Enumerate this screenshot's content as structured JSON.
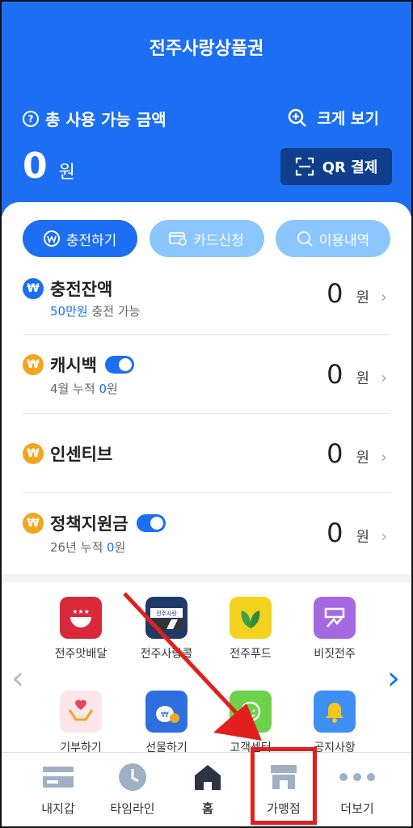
{
  "header": {
    "app_title": "전주사랑상품권",
    "total_label": "총 사용 가능 금액",
    "zoom_label": "크게 보기",
    "total_amount": "0",
    "total_unit": "원",
    "qr_label": "QR 결제",
    "bg_color": "#1c6ef2"
  },
  "actions": [
    {
      "label": "충전하기",
      "icon": "won-icon"
    },
    {
      "label": "카드신청",
      "icon": "card-icon"
    },
    {
      "label": "이용내역",
      "icon": "search-icon"
    }
  ],
  "balances": [
    {
      "title": "충전잔액",
      "sub_highlight": "50만원",
      "sub_rest": " 충전 가능",
      "amount": "0",
      "unit": "원",
      "toggle": false
    },
    {
      "title": "캐시백",
      "sub_prefix": "4월 누적 ",
      "sub_highlight": "0",
      "sub_rest": "원",
      "amount": "0",
      "unit": "원",
      "toggle": true
    },
    {
      "title": "인센티브",
      "amount": "0",
      "unit": "원",
      "toggle": false
    },
    {
      "title": "정책지원금",
      "sub_prefix": "26년 누적 ",
      "sub_highlight": "0",
      "sub_rest": "원",
      "amount": "0",
      "unit": "원",
      "toggle": true
    }
  ],
  "apps": [
    {
      "label": "전주맛배달",
      "icon": "delivery-icon"
    },
    {
      "label": "전주사랑콜",
      "icon": "taxi-icon"
    },
    {
      "label": "전주푸드",
      "icon": "leaf-icon"
    },
    {
      "label": "비짓전주",
      "icon": "visit-icon"
    },
    {
      "label": "기부하기",
      "icon": "heart-hands-icon"
    },
    {
      "label": "선물하기",
      "icon": "gift-icon"
    },
    {
      "label": "고객센터",
      "icon": "support-icon"
    },
    {
      "label": "공지사항",
      "icon": "bell-icon"
    }
  ],
  "tabs": [
    {
      "label": "내지갑",
      "icon": "wallet-icon"
    },
    {
      "label": "타임라인",
      "icon": "clock-icon"
    },
    {
      "label": "홈",
      "icon": "home-icon"
    },
    {
      "label": "가맹점",
      "icon": "store-icon"
    },
    {
      "label": "더보기",
      "icon": "more-icon"
    }
  ],
  "annotation": {
    "color": "#e21f1f"
  }
}
